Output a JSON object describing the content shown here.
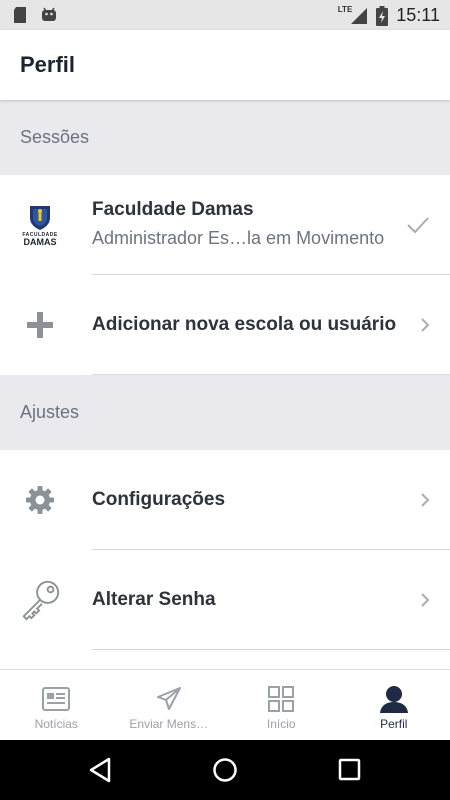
{
  "status_bar": {
    "time": "15:11",
    "network": "LTE",
    "left_icons": [
      "sd-card-icon",
      "android-icon"
    ]
  },
  "header": {
    "title": "Perfil"
  },
  "sections": [
    {
      "title": "Sessões",
      "items": [
        {
          "title": "Faculdade Damas",
          "subtitle": "Administrador Es…la em Movimento",
          "icon": "faculdade-damas-logo",
          "logo_text": "FACULDADE",
          "logo_text2": "DAMAS",
          "trailing": "check-icon"
        },
        {
          "title": "Adicionar nova escola ou usuário",
          "icon": "plus-icon",
          "trailing": "chevron-right-icon"
        }
      ]
    },
    {
      "title": "Ajustes",
      "items": [
        {
          "title": "Configurações",
          "icon": "gear-icon",
          "trailing": "chevron-right-icon"
        },
        {
          "title": "Alterar Senha",
          "icon": "key-icon",
          "trailing": "chevron-right-icon"
        }
      ]
    }
  ],
  "bottom_nav": {
    "items": [
      {
        "label": "Notícias",
        "icon": "news-icon",
        "active": false
      },
      {
        "label": "Enviar Mens…",
        "icon": "send-icon",
        "active": false
      },
      {
        "label": "Início",
        "icon": "grid-icon",
        "active": false
      },
      {
        "label": "Perfil",
        "icon": "profile-icon",
        "active": true
      }
    ]
  },
  "colors": {
    "accent": "#1f2a44",
    "background": "#ebebf0",
    "inactive": "#9aa1a9"
  }
}
